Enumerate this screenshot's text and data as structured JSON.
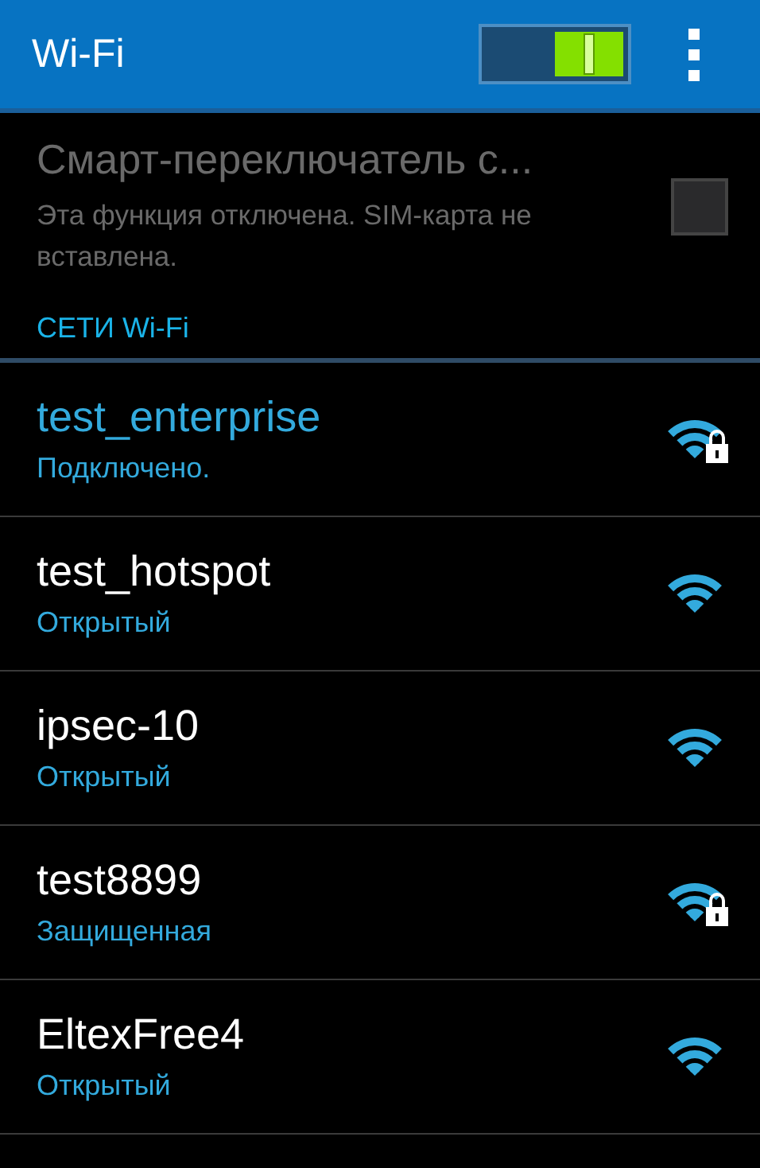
{
  "action_bar": {
    "title": "Wi-Fi",
    "switch_on": true
  },
  "smart_switch": {
    "title": "Смарт-переключатель с...",
    "summary": "Эта функция отключена. SIM-карта не вставлена.",
    "disabled": true,
    "checked": false
  },
  "section": {
    "title": "СЕТИ Wi-Fi"
  },
  "networks": [
    {
      "name": "test_enterprise",
      "status": "Подключено.",
      "connected": true,
      "secured": true
    },
    {
      "name": "test_hotspot",
      "status": "Открытый",
      "connected": false,
      "secured": false
    },
    {
      "name": "ipsec-10",
      "status": "Открытый",
      "connected": false,
      "secured": false
    },
    {
      "name": "test8899",
      "status": "Защищенная",
      "connected": false,
      "secured": true
    },
    {
      "name": "EltexFree4",
      "status": "Открытый",
      "connected": false,
      "secured": false
    }
  ]
}
